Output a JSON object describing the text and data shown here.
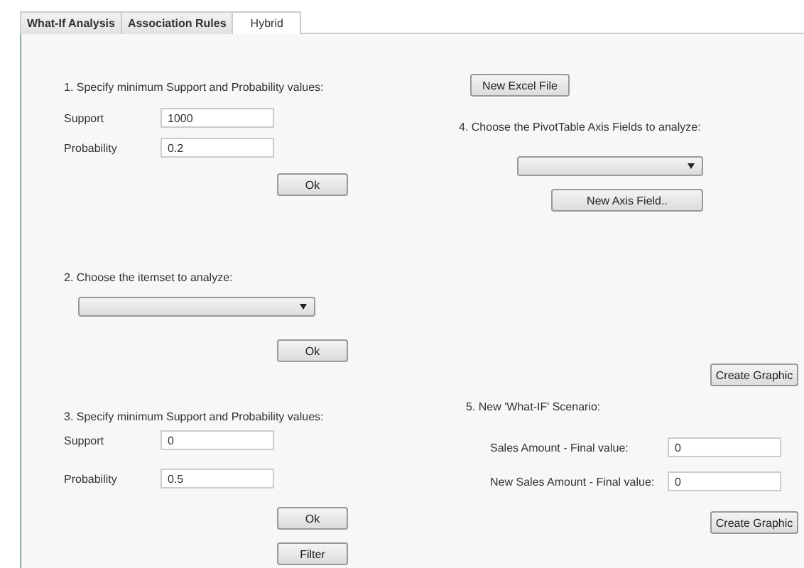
{
  "tabs": [
    {
      "label": "What-If Analysis",
      "selected": false
    },
    {
      "label": "Association Rules",
      "selected": false
    },
    {
      "label": "Hybrid",
      "selected": true
    }
  ],
  "section1": {
    "heading": "1. Specify minimum Support and Probability values:",
    "fields": [
      {
        "label": "Support",
        "value": "1000"
      },
      {
        "label": "Probability",
        "value": "0.2"
      }
    ],
    "button": "Ok"
  },
  "section2": {
    "heading": "2. Choose the itemset to analyze:",
    "button": "Ok"
  },
  "section3": {
    "heading": "3. Specify minimum Support and Probability values:",
    "fields": [
      {
        "label": "Support",
        "value": "0"
      },
      {
        "label": "Probability",
        "value": "0.5"
      }
    ],
    "buttons": [
      "Ok",
      "Filter"
    ]
  },
  "excel_button": "New Excel File",
  "section4": {
    "heading": "4. Choose the PivotTable Axis Fields to analyze:",
    "button": "New Axis Field..",
    "graphic_button": "Create Graphic"
  },
  "section5": {
    "heading": "5. New 'What-IF' Scenario:",
    "fields": [
      {
        "label": "Sales Amount - Final value:",
        "value": "0"
      },
      {
        "label": "New Sales Amount - Final value:",
        "value": "0"
      }
    ],
    "button": "Create Graphic"
  }
}
